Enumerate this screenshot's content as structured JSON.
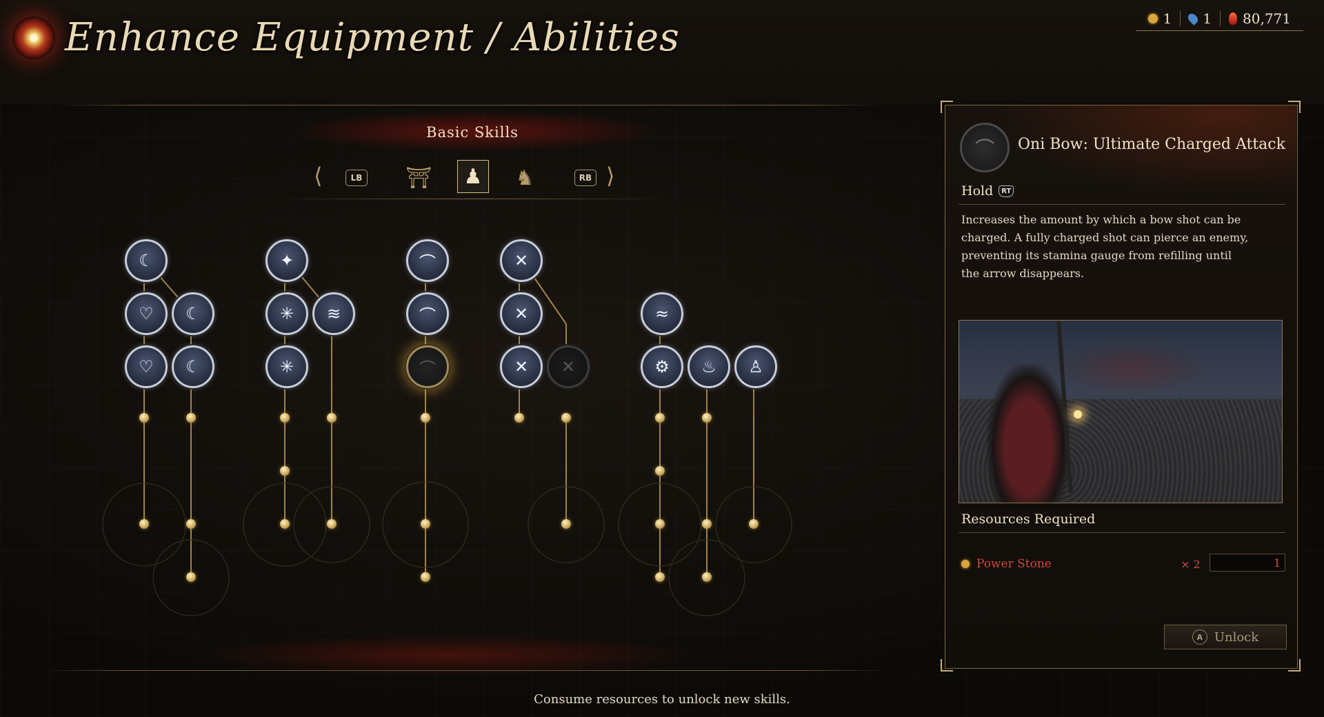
{
  "header": {
    "title": "Enhance Equipment / Abilities",
    "currencies": [
      {
        "icon": "power-stone-icon",
        "value": "1"
      },
      {
        "icon": "water-drop-icon",
        "value": "1"
      },
      {
        "icon": "amrita-flame-icon",
        "value": "80,771"
      }
    ]
  },
  "skills": {
    "section_title": "Basic Skills",
    "prev_button": "LB",
    "next_button": "RB",
    "tabs": [
      {
        "icon": "sword-category-icon",
        "selected": false
      },
      {
        "icon": "ninjutsu-category-icon",
        "selected": false
      },
      {
        "icon": "guardian-spirit-category-icon",
        "selected": true
      },
      {
        "icon": "oni-mask-category-icon",
        "selected": false
      }
    ],
    "hint": "Consume resources to unlock new skills."
  },
  "detail": {
    "title": "Oni Bow: Ultimate Charged Attack",
    "input_label": "Hold",
    "input_button": "RT",
    "description": "Increases the amount by which a bow shot can be charged. A fully charged shot can pierce an enemy, preventing its stamina gauge from refilling until the arrow disappears.",
    "resources_title": "Resources Required",
    "resource_name": "Power Stone",
    "resource_qty": "× 2",
    "resource_owned": "1",
    "unlock_button": "A",
    "unlock_label": "Unlock",
    "colors": {
      "insufficient": "#d24a3c",
      "accent": "#c9b07c"
    }
  }
}
